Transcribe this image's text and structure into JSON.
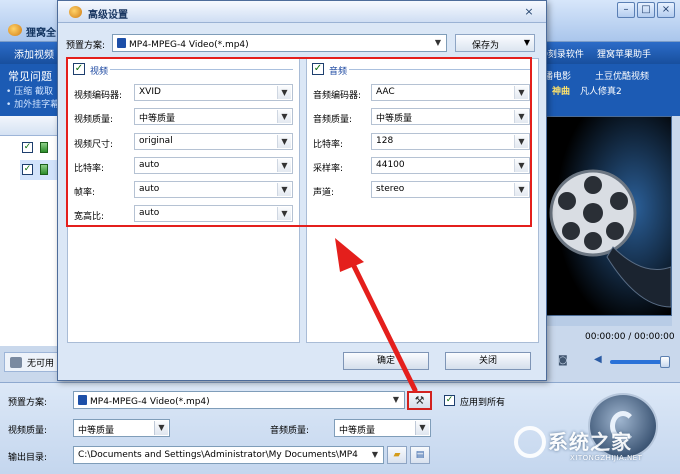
{
  "app": {
    "title": "狸窝全",
    "tab_left": "添加视频",
    "tab_right_1": "D刻录软件",
    "tab_right_2": "狸窝苹果助手",
    "faq_title": "常见问题",
    "faq_lines": [
      "• 压缩  截取",
      "• 加外挂字幕"
    ],
    "promo_1": "播电影",
    "promo_2": "土豆优酷视频",
    "promo_3": "神曲",
    "promo_4": "凡人修真2",
    "unavailable_label": "无可用",
    "time_display": "00:00:00 / 00:00:00",
    "bottom": {
      "preset_label": "预置方案:",
      "preset_value": "MP4-MPEG-4 Video(*.mp4)",
      "apply_all_label": "应用到所有",
      "video_quality_label": "视频质量:",
      "video_quality_value": "中等质量",
      "audio_quality_label": "音频质量:",
      "audio_quality_value": "中等质量",
      "output_label": "输出目录:",
      "output_value": "C:\\Documents and Settings\\Administrator\\My Documents\\MP4"
    },
    "watermark_text": "系统之家",
    "watermark_url": "XITONGZHIJIA.NET"
  },
  "dialog": {
    "title": "高级设置",
    "close": "×",
    "preset_label": "预置方案:",
    "preset_value": "MP4-MPEG-4 Video(*.mp4)",
    "save_as": "保存为",
    "ok": "确定",
    "close_button": "关闭",
    "video": {
      "title": "视频",
      "rows": [
        {
          "label": "视频编码器:",
          "value": "XVID"
        },
        {
          "label": "视频质量:",
          "value": "中等质量"
        },
        {
          "label": "视频尺寸:",
          "value": "original"
        },
        {
          "label": "比特率:",
          "value": "auto"
        },
        {
          "label": "帧率:",
          "value": "auto"
        },
        {
          "label": "宽高比:",
          "value": "auto"
        }
      ]
    },
    "audio": {
      "title": "音频",
      "rows": [
        {
          "label": "音频编码器:",
          "value": "AAC"
        },
        {
          "label": "音频质量:",
          "value": "中等质量"
        },
        {
          "label": "比特率:",
          "value": "128"
        },
        {
          "label": "采样率:",
          "value": "44100"
        },
        {
          "label": "声道:",
          "value": "stereo"
        }
      ]
    }
  },
  "colors": {
    "highlight_red": "#e41f1c",
    "accent_blue": "#1c5bb4"
  },
  "icons": {
    "dropdown": "▼",
    "checked": "✓",
    "tools": "⚒"
  }
}
